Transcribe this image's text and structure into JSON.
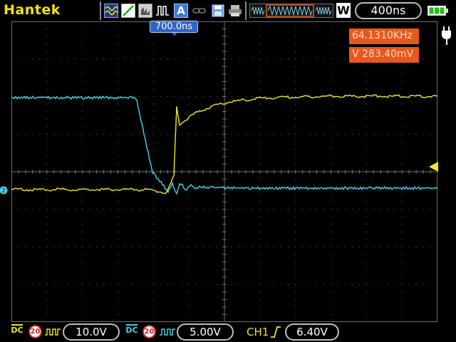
{
  "brand": "Hantek",
  "toolbar": {
    "acquire_mode_icon": "wave-mode-icon",
    "slope_icon": "slope-icon",
    "persist_icon": "persist-icon",
    "pulse_icon": "pulse-icon",
    "auto_label": "A",
    "link_icon": "link-icon",
    "save_icon": "save-icon",
    "print_icon": "print-icon",
    "memory_icon": "memory-icon",
    "window_label": "W",
    "timebase": "400ns",
    "battery_icon": "battery-icon",
    "power_icon": "power-plug-icon"
  },
  "trigger_time": "700.0ns",
  "readouts": {
    "frequency": "64.1310KHz",
    "voltage": "V 283.40mV"
  },
  "channels": {
    "ch1": {
      "coupling": "DC",
      "bw_limit": "20",
      "scale": "10.0V",
      "color": "#f0e820"
    },
    "ch2": {
      "coupling": "DC",
      "bw_limit": "20",
      "scale": "5.00V",
      "color": "#3ed6e6"
    }
  },
  "trigger": {
    "source": "CH1",
    "level": "6.40V",
    "edge": "rising-edge-icon"
  },
  "colors": {
    "ch1": "#f0e820",
    "ch2": "#3ed6e6",
    "grid": "#6e6e6e",
    "readout_bg": "#e8581c"
  }
}
